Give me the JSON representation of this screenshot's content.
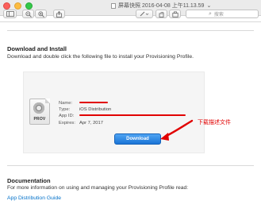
{
  "window": {
    "title": "屏幕快照 2016-04-08 上午11.13.59",
    "title_suffix": "⌄"
  },
  "toolbar": {
    "sidebar_icon": "sidebar-icon",
    "zoom_out_icon": "zoom-out-icon",
    "zoom_in_icon": "zoom-in-icon",
    "share_icon": "share-icon",
    "markup_icon": "pen-icon",
    "rotate_icon": "rotate-icon",
    "toolbox_icon": "toolbox-icon",
    "search_placeholder": "搜索"
  },
  "download_section": {
    "heading": "Download and Install",
    "description": "Download and double click the following file to install your Provisioning Profile."
  },
  "profile": {
    "icon_label": "PROV",
    "fields": [
      {
        "key": "Name:",
        "value": ""
      },
      {
        "key": "Type:",
        "value": "iOS Distribution"
      },
      {
        "key": "App ID:",
        "value": ""
      },
      {
        "key": "Expires:",
        "value": "Apr 7, 2017"
      }
    ],
    "download_label": "Download"
  },
  "annotation": {
    "text": "下载描述文件",
    "color": "#e10000"
  },
  "documentation": {
    "heading": "Documentation",
    "description": "For more information on using and managing your Provisioning Profile read:",
    "link_text": "App Distribution Guide"
  },
  "colors": {
    "button_blue": "#1a74d6",
    "link_blue": "#0070c9",
    "annotation_red": "#e10000"
  }
}
